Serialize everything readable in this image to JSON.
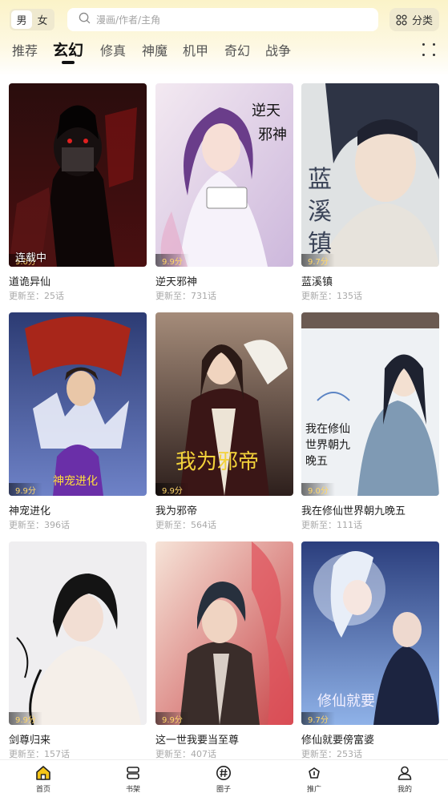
{
  "gender": {
    "male": "男",
    "female": "女"
  },
  "search": {
    "placeholder": "漫画/作者/主角"
  },
  "category_button": "分类",
  "tabs": [
    "推荐",
    "玄幻",
    "修真",
    "神魔",
    "机甲",
    "奇幻",
    "战争"
  ],
  "active_tab": "玄幻",
  "comics": [
    {
      "title": "道诡异仙",
      "update": "更新至：25话",
      "score": "9.0分",
      "badge": "连载中"
    },
    {
      "title": "逆天邪神",
      "update": "更新至：731话",
      "score": "9.9分",
      "cover_text": "逆天邪神"
    },
    {
      "title": "蓝溪镇",
      "update": "更新至：135话",
      "score": "9.7分",
      "cover_text": "蓝溪镇"
    },
    {
      "title": "神宠进化",
      "update": "更新至：396话",
      "score": "9.9分",
      "cover_text": "神宠进化"
    },
    {
      "title": "我为邪帝",
      "update": "更新至：564话",
      "score": "9.9分",
      "cover_text": "我为邪帝"
    },
    {
      "title": "我在修仙世界朝九晚五",
      "update": "更新至：111话",
      "score": "9.0分",
      "cover_text": "我在修仙世界朝九晚五"
    },
    {
      "title": "剑尊归来",
      "update": "更新至：157话",
      "score": "9.9分"
    },
    {
      "title": "这一世我要当至尊",
      "update": "更新至：407话",
      "score": "9.9分"
    },
    {
      "title": "修仙就要傍富婆",
      "update": "更新至：253话",
      "score": "9.7分",
      "cover_text": "修仙就要傍富婆"
    }
  ],
  "nav": [
    {
      "label": "首页",
      "icon": "home-icon",
      "active": true
    },
    {
      "label": "书架",
      "icon": "bookshelf-icon"
    },
    {
      "label": "圈子",
      "icon": "hashtag-icon"
    },
    {
      "label": "推广",
      "icon": "promote-icon"
    },
    {
      "label": "我的",
      "icon": "user-icon"
    }
  ],
  "colors": {
    "accent_yellow": "#f5c518",
    "header_bg": "#fbf3c8",
    "score_text": "#ffd76a"
  }
}
